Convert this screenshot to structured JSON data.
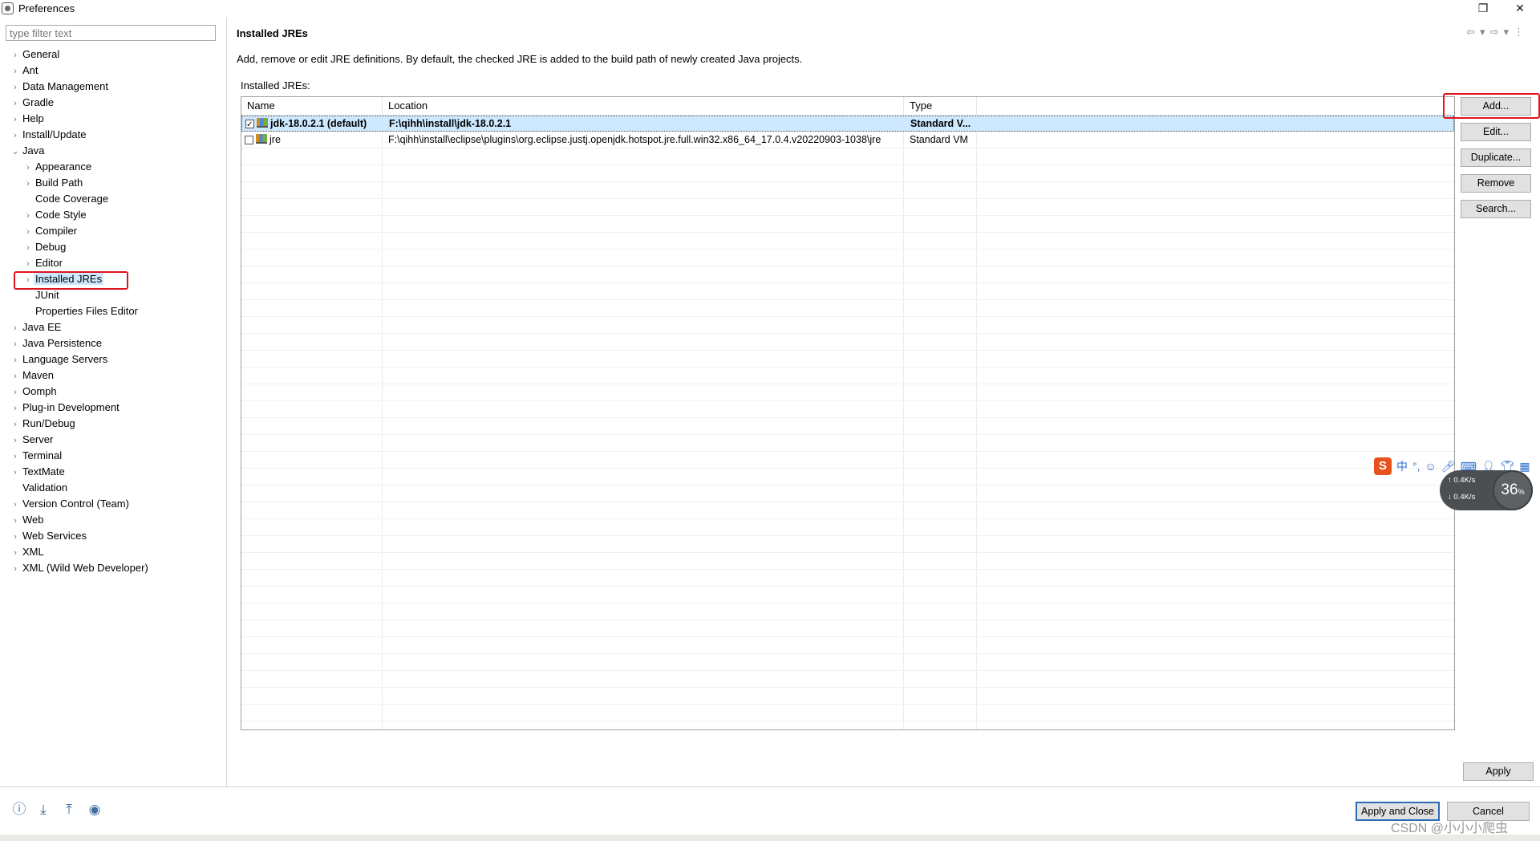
{
  "window": {
    "title": "Preferences",
    "controls": {
      "restore": "❐",
      "close": "✕"
    }
  },
  "sidebar": {
    "filter_placeholder": "type filter text",
    "items": [
      {
        "label": "General",
        "expandable": true,
        "level": 0
      },
      {
        "label": "Ant",
        "expandable": true,
        "level": 0
      },
      {
        "label": "Data Management",
        "expandable": true,
        "level": 0
      },
      {
        "label": "Gradle",
        "expandable": true,
        "level": 0
      },
      {
        "label": "Help",
        "expandable": true,
        "level": 0
      },
      {
        "label": "Install/Update",
        "expandable": true,
        "level": 0
      },
      {
        "label": "Java",
        "expandable": true,
        "expanded": true,
        "level": 0
      },
      {
        "label": "Appearance",
        "expandable": true,
        "level": 1
      },
      {
        "label": "Build Path",
        "expandable": true,
        "level": 1
      },
      {
        "label": "Code Coverage",
        "expandable": false,
        "level": 1
      },
      {
        "label": "Code Style",
        "expandable": true,
        "level": 1
      },
      {
        "label": "Compiler",
        "expandable": true,
        "level": 1
      },
      {
        "label": "Debug",
        "expandable": true,
        "level": 1
      },
      {
        "label": "Editor",
        "expandable": true,
        "level": 1
      },
      {
        "label": "Installed JREs",
        "expandable": true,
        "level": 1,
        "selected": true
      },
      {
        "label": "JUnit",
        "expandable": false,
        "level": 1
      },
      {
        "label": "Properties Files Editor",
        "expandable": false,
        "level": 1
      },
      {
        "label": "Java EE",
        "expandable": true,
        "level": 0
      },
      {
        "label": "Java Persistence",
        "expandable": true,
        "level": 0
      },
      {
        "label": "Language Servers",
        "expandable": true,
        "level": 0
      },
      {
        "label": "Maven",
        "expandable": true,
        "level": 0
      },
      {
        "label": "Oomph",
        "expandable": true,
        "level": 0
      },
      {
        "label": "Plug-in Development",
        "expandable": true,
        "level": 0
      },
      {
        "label": "Run/Debug",
        "expandable": true,
        "level": 0
      },
      {
        "label": "Server",
        "expandable": true,
        "level": 0
      },
      {
        "label": "Terminal",
        "expandable": true,
        "level": 0
      },
      {
        "label": "TextMate",
        "expandable": true,
        "level": 0
      },
      {
        "label": "Validation",
        "expandable": false,
        "level": 0
      },
      {
        "label": "Version Control (Team)",
        "expandable": true,
        "level": 0
      },
      {
        "label": "Web",
        "expandable": true,
        "level": 0
      },
      {
        "label": "Web Services",
        "expandable": true,
        "level": 0
      },
      {
        "label": "XML",
        "expandable": true,
        "level": 0
      },
      {
        "label": "XML (Wild Web Developer)",
        "expandable": true,
        "level": 0
      }
    ]
  },
  "page": {
    "title": "Installed JREs",
    "description": "Add, remove or edit JRE definitions. By default, the checked JRE is added to the build path of newly created Java projects.",
    "list_label": "Installed JREs:",
    "columns": [
      "Name",
      "Location",
      "Type"
    ],
    "rows": [
      {
        "checked": true,
        "selected": true,
        "name": "jdk-18.0.2.1 (default)",
        "location": "F:\\qihh\\install\\jdk-18.0.2.1",
        "type": "Standard V..."
      },
      {
        "checked": false,
        "selected": false,
        "name": "jre",
        "location": "F:\\qihh\\install\\eclipse\\plugins\\org.eclipse.justj.openjdk.hotspot.jre.full.win32.x86_64_17.0.4.v20220903-1038\\jre",
        "type": "Standard VM"
      }
    ],
    "buttons": [
      "Add...",
      "Edit...",
      "Duplicate...",
      "Remove",
      "Search..."
    ],
    "apply": "Apply"
  },
  "footer": {
    "apply_close": "Apply and Close",
    "cancel": "Cancel",
    "icons": [
      "help-icon",
      "import-icon",
      "export-icon",
      "oomph-icon"
    ]
  },
  "overlay": {
    "ime": {
      "logo": "S",
      "lang": "中",
      "punct": "°,"
    },
    "net": {
      "up": "0.4K/s",
      "down": "0.4K/s",
      "percent": "36",
      "unit": "%"
    },
    "watermark": "CSDN @小小小爬虫"
  }
}
